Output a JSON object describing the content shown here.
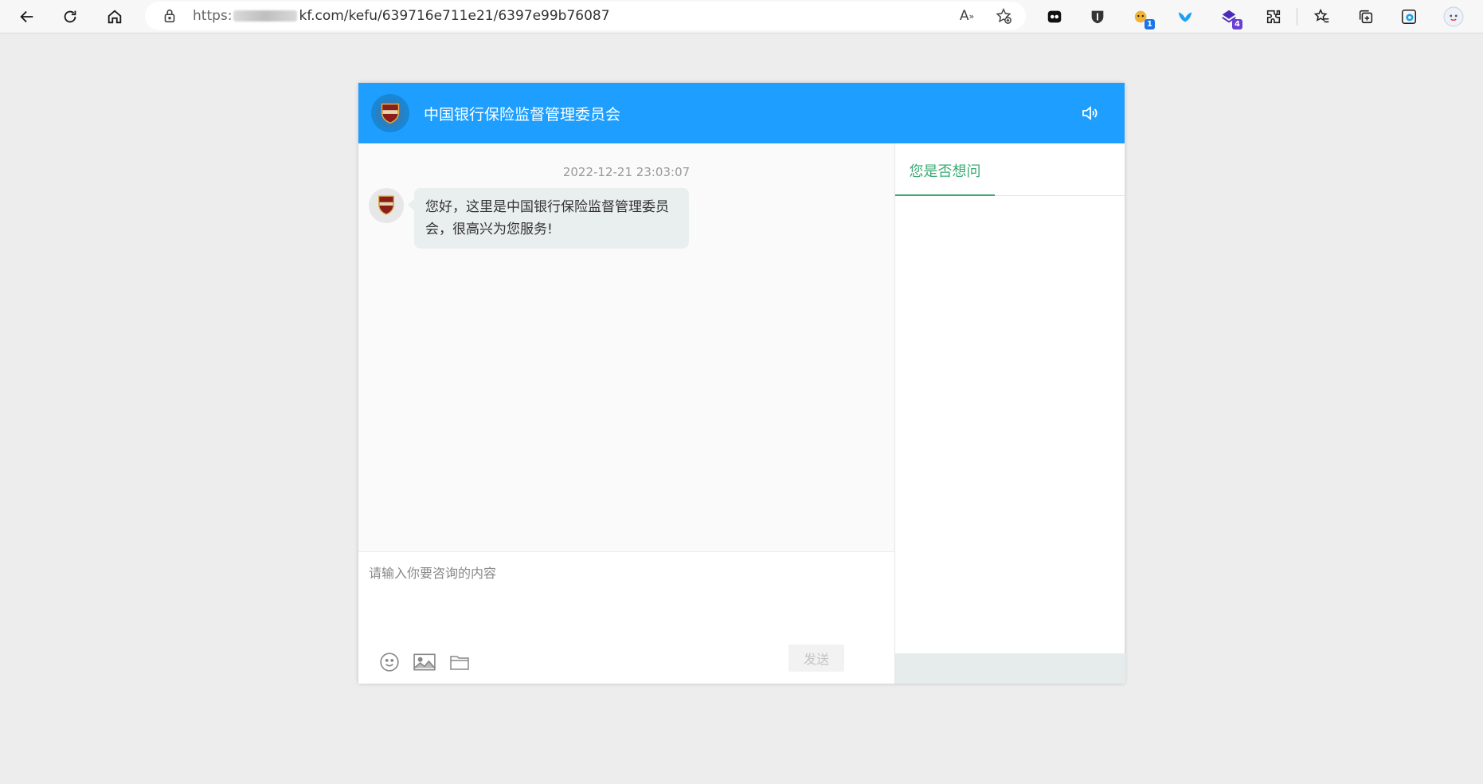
{
  "browser": {
    "url_scheme": "https:",
    "url_rest": "kf.com/kefu/639716e711e21/6397e99b76087",
    "extensions": [
      {
        "name": "ext-mask-icon",
        "badge": ""
      },
      {
        "name": "ext-shield-icon",
        "badge": ""
      },
      {
        "name": "ext-cat-icon",
        "badge": "1",
        "badge_color": "#1a73e8"
      },
      {
        "name": "ext-bird-icon",
        "badge": ""
      },
      {
        "name": "ext-purple-icon",
        "badge": "4",
        "badge_color": "#6a3fd6"
      }
    ]
  },
  "chat": {
    "title": "中国银行保险监督管理委员会",
    "timestamp": "2022-12-21 23:03:07",
    "message_text": "您好，这里是中国银行保险监督管理委员会，很高兴为您服务!",
    "input_placeholder": "请输入你要咨询的内容",
    "send_label": "发送",
    "side_tab_label": "您是否想问",
    "colors": {
      "header": "#1e9fff",
      "tab_accent": "#3aa972"
    }
  }
}
